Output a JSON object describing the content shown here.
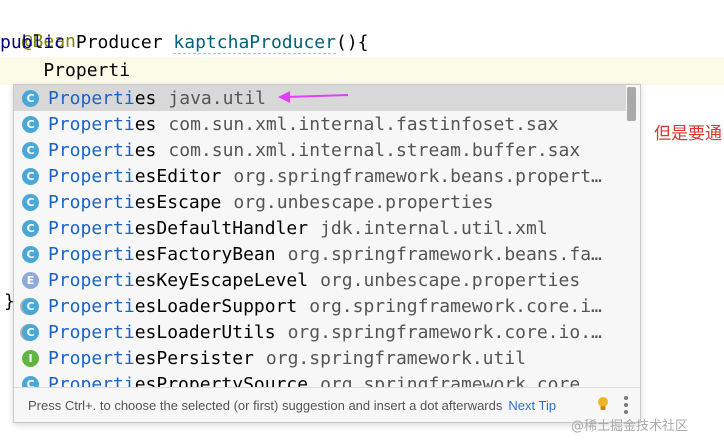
{
  "editor": {
    "line1": "@Bean",
    "line2_kw": "public",
    "line2_type": "Producer",
    "line2_fn": "kaptchaProducer",
    "line2_tail": "(){",
    "line3": "    Properti",
    "line4": "}"
  },
  "completion": {
    "typed": "Properti",
    "items": [
      {
        "icon": "C",
        "kind": "c",
        "match": "Properti",
        "rest": "es",
        "pkg": "java.util"
      },
      {
        "icon": "C",
        "kind": "c",
        "match": "Properti",
        "rest": "es",
        "pkg": "com.sun.xml.internal.fastinfoset.sax"
      },
      {
        "icon": "C",
        "kind": "c",
        "match": "Properti",
        "rest": "es",
        "pkg": "com.sun.xml.internal.stream.buffer.sax"
      },
      {
        "icon": "C",
        "kind": "c",
        "match": "Properti",
        "rest": "esEditor",
        "pkg": "org.springframework.beans.propert…"
      },
      {
        "icon": "C",
        "kind": "c",
        "match": "Properti",
        "rest": "esEscape",
        "pkg": "org.unbescape.properties"
      },
      {
        "icon": "C",
        "kind": "c",
        "match": "Properti",
        "rest": "esDefaultHandler",
        "pkg": "jdk.internal.util.xml"
      },
      {
        "icon": "C",
        "kind": "c",
        "match": "Properti",
        "rest": "esFactoryBean",
        "pkg": "org.springframework.beans.fa…"
      },
      {
        "icon": "E",
        "kind": "e",
        "match": "Properti",
        "rest": "esKeyEscapeLevel",
        "pkg": "org.unbescape.properties"
      },
      {
        "icon": "C",
        "kind": "ca",
        "match": "Properti",
        "rest": "esLoaderSupport",
        "pkg": "org.springframework.core.i…"
      },
      {
        "icon": "C",
        "kind": "ca",
        "match": "Properti",
        "rest": "esLoaderUtils",
        "pkg": "org.springframework.core.io.…"
      },
      {
        "icon": "I",
        "kind": "i",
        "match": "Properti",
        "rest": "esPersister",
        "pkg": "org.springframework.util"
      },
      {
        "icon": "C",
        "kind": "c",
        "match": "Properti",
        "rest": "esPropertySource",
        "pkg": "org.springframework.core"
      }
    ],
    "footer_hint": "Press Ctrl+. to choose the selected (or first) suggestion and insert a dot afterwards",
    "footer_tip": "Next Tip"
  },
  "annotation_text": "但是要通",
  "watermark": "@稀土掘金技术社区",
  "colors": {
    "match": "#1a63c9",
    "arrow": "#e040fb",
    "annotation": "#d9372c"
  }
}
